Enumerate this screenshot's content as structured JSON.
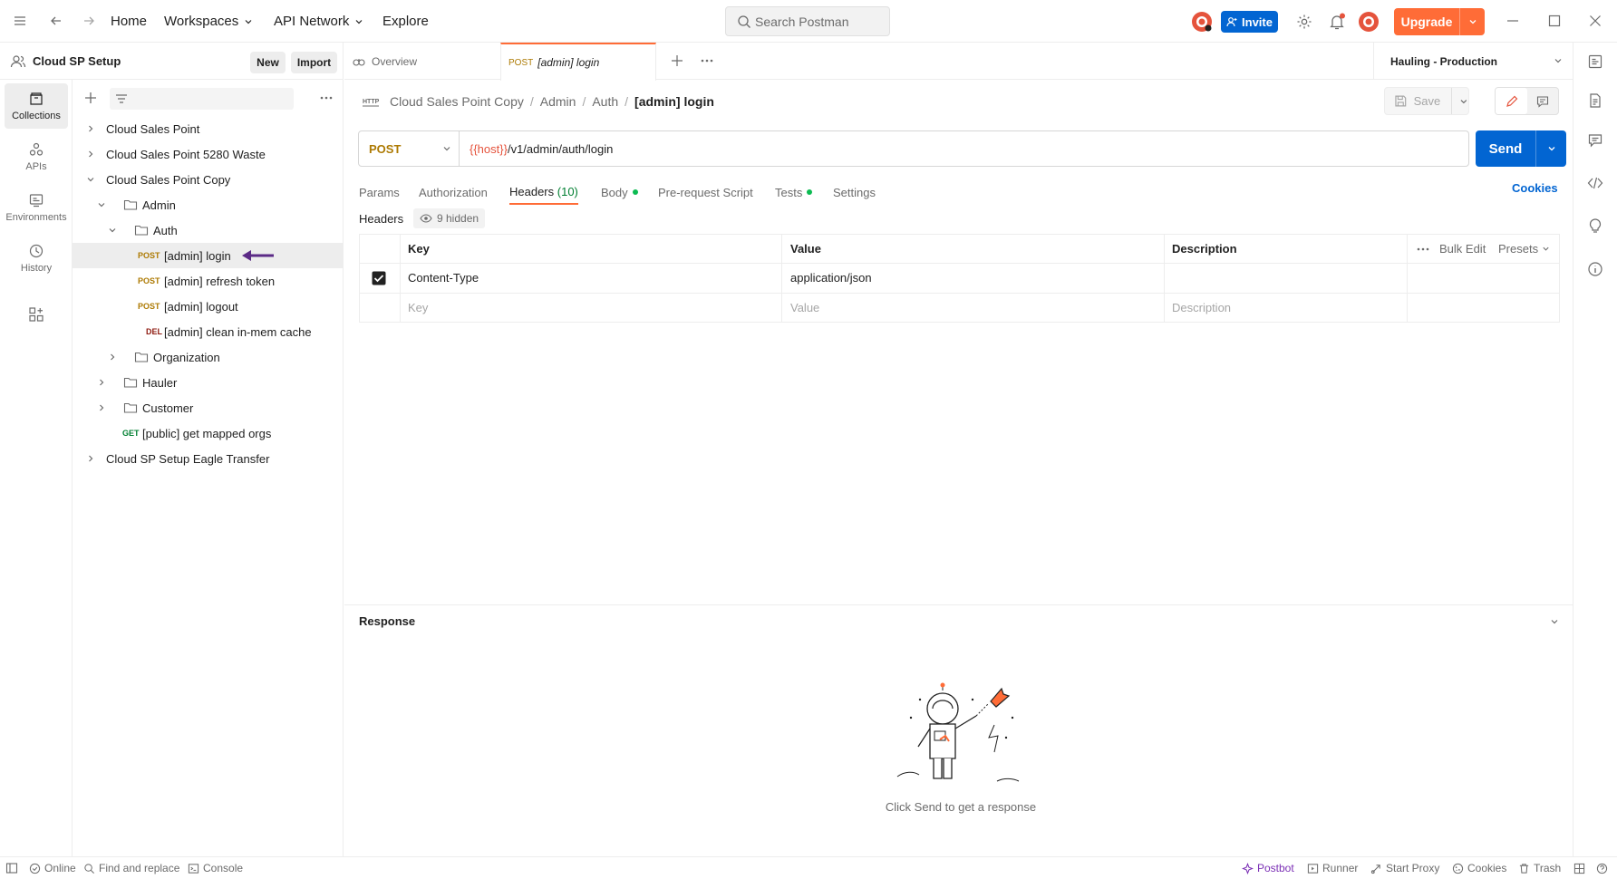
{
  "topbar": {
    "home": "Home",
    "workspaces": "Workspaces",
    "api_network": "API Network",
    "explore": "Explore",
    "search_placeholder": "Search Postman",
    "invite": "Invite",
    "upgrade": "Upgrade"
  },
  "workspace": {
    "name": "Cloud SP Setup",
    "new_label": "New",
    "import_label": "Import"
  },
  "rail": [
    {
      "label": "Collections",
      "icon": "collections-icon"
    },
    {
      "label": "APIs",
      "icon": "apis-icon"
    },
    {
      "label": "Environments",
      "icon": "environments-icon"
    },
    {
      "label": "History",
      "icon": "history-icon"
    }
  ],
  "tree": {
    "items": [
      {
        "label": "Cloud Sales Point"
      },
      {
        "label": "Cloud Sales Point 5280 Waste"
      },
      {
        "label": "Cloud Sales Point Copy"
      },
      {
        "label": "Admin"
      },
      {
        "label": "Auth"
      },
      {
        "method": "POST",
        "label": "[admin] login"
      },
      {
        "method": "POST",
        "label": "[admin] refresh token"
      },
      {
        "method": "POST",
        "label": "[admin] logout"
      },
      {
        "method": "DEL",
        "label": "[admin] clean in-mem cache"
      },
      {
        "label": "Organization"
      },
      {
        "label": "Hauler"
      },
      {
        "label": "Customer"
      },
      {
        "method": "GET",
        "label": "[public] get mapped orgs"
      },
      {
        "label": "Cloud SP Setup Eagle Transfer"
      }
    ]
  },
  "tabs": {
    "overview": "Overview",
    "active_method": "POST",
    "active_label": "[admin] login",
    "environment": "Hauling - Production"
  },
  "breadcrumb": {
    "items": [
      "Cloud Sales Point Copy",
      "Admin",
      "Auth"
    ],
    "current": "[admin] login",
    "save": "Save"
  },
  "request": {
    "method": "POST",
    "url_var": "{{host}}",
    "url_path": "/v1/admin/auth/login",
    "send": "Send",
    "tabs": {
      "params": "Params",
      "authorization": "Authorization",
      "headers": "Headers",
      "headers_count": "(10)",
      "body": "Body",
      "prerequest": "Pre-request Script",
      "tests": "Tests",
      "settings": "Settings"
    },
    "cookies": "Cookies"
  },
  "headers": {
    "label": "Headers",
    "hidden": "9 hidden",
    "columns": {
      "key": "Key",
      "value": "Value",
      "description": "Description"
    },
    "bulk_edit": "Bulk Edit",
    "presets": "Presets",
    "rows": [
      {
        "checked": true,
        "key": "Content-Type",
        "value": "application/json",
        "description": ""
      }
    ],
    "placeholders": {
      "key": "Key",
      "value": "Value",
      "description": "Description"
    }
  },
  "response": {
    "label": "Response",
    "empty": "Click Send to get a response"
  },
  "statusbar": {
    "online": "Online",
    "find_replace": "Find and replace",
    "console": "Console",
    "postbot": "Postbot",
    "runner": "Runner",
    "start_proxy": "Start Proxy",
    "cookies": "Cookies",
    "trash": "Trash"
  },
  "colors": {
    "accent": "#ff6c37",
    "primary": "#0265d2",
    "post": "#ad7a03",
    "get": "#007f31",
    "del": "#8e1a10",
    "annotation_arrow": "#5b2a86"
  }
}
